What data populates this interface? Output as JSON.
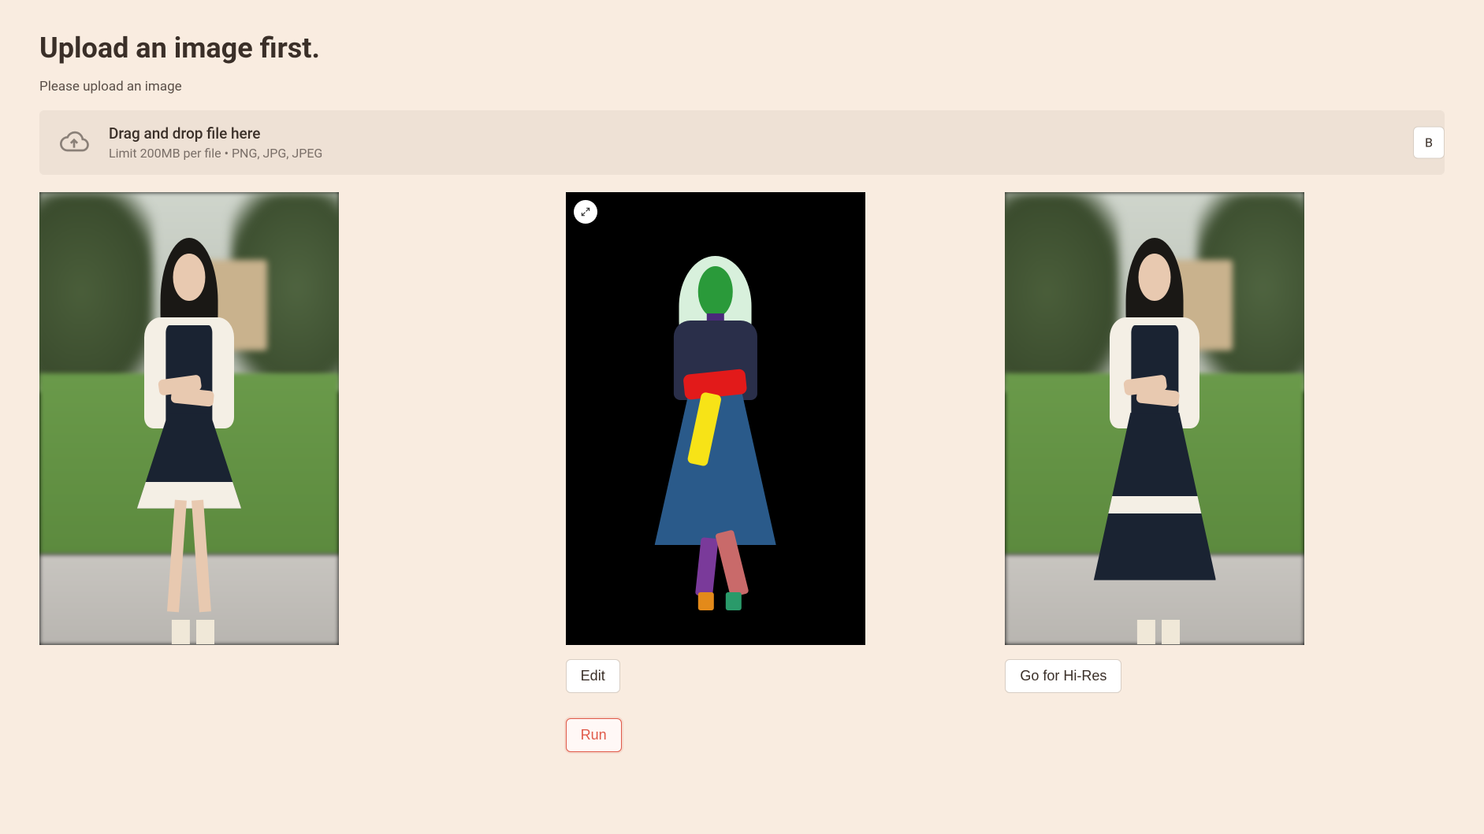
{
  "header": {
    "title": "Upload an image first.",
    "subtitle": "Please upload an image"
  },
  "dropzone": {
    "line1": "Drag and drop file here",
    "line2": "Limit 200MB per file • PNG, JPG, JPEG",
    "browse_initial": "B"
  },
  "columns": {
    "left": {
      "alt": "original-photo"
    },
    "middle": {
      "alt": "segmentation-mask",
      "edit_label": "Edit",
      "run_label": "Run"
    },
    "right": {
      "alt": "result-photo",
      "hires_label": "Go for Hi-Res"
    }
  },
  "icons": {
    "upload": "cloud-upload",
    "fullscreen": "expand"
  }
}
